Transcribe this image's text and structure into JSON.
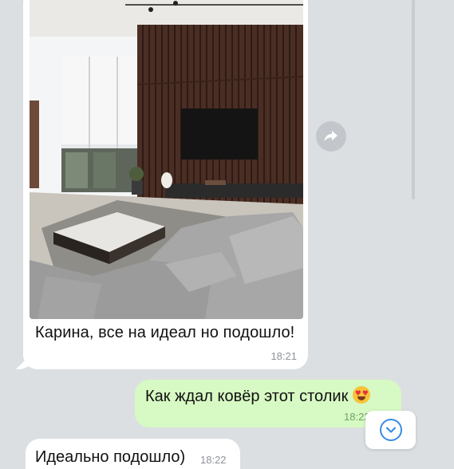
{
  "messages": {
    "photo_caption": "Карина, все на идеал но подошло!",
    "photo_time": "18:21",
    "outgoing_text": "Как ждал ковёр этот столик",
    "outgoing_time": "18:22",
    "last_text": "Идеально подошло)",
    "last_time": "18:22"
  },
  "icons": {
    "forward": "forward-arrow-icon",
    "scroll_down": "chevron-down-icon",
    "emoji": "heart-eyes-emoji"
  },
  "colors": {
    "incoming_bubble": "#ffffff",
    "outgoing_bubble": "#d7f9c3",
    "accent": "#3a8ce0"
  }
}
